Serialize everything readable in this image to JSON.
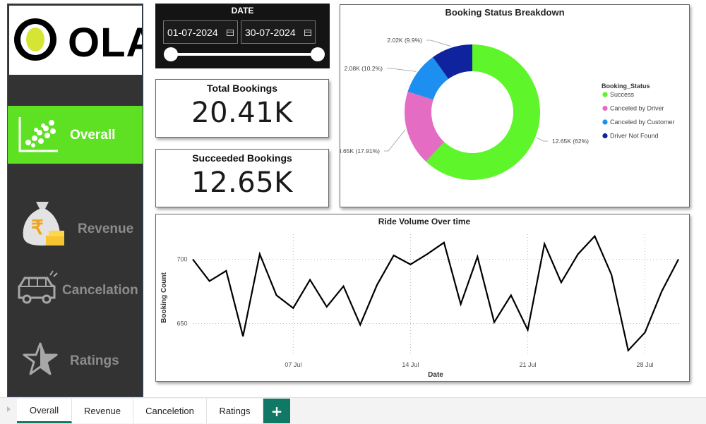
{
  "sidebar": {
    "logo_text": "OLA",
    "items": [
      {
        "label": "Overall",
        "icon": "scatter-chart-icon",
        "active": true
      },
      {
        "label": "Revenue",
        "icon": "money-bag-icon",
        "active": false
      },
      {
        "label": "Cancelation",
        "icon": "car-icon",
        "active": false
      },
      {
        "label": "Ratings",
        "icon": "star-icon",
        "active": false
      }
    ]
  },
  "date_filter": {
    "title": "DATE",
    "start": "01-07-2024",
    "end": "30-07-2024"
  },
  "kpis": {
    "total_bookings": {
      "title": "Total Bookings",
      "value": "20.41K"
    },
    "succeeded_bookings": {
      "title": "Succeeded Bookings",
      "value": "12.65K"
    }
  },
  "donut": {
    "title": "Booking Status Breakdown",
    "legend_title": "Booking_Status",
    "slices": [
      {
        "name": "Success",
        "value": 12650,
        "label": "12.65K (62%)",
        "color": "#5ef52a"
      },
      {
        "name": "Canceled by Driver",
        "value": 3650,
        "label": "3.65K (17.91%)",
        "color": "#e46cc3"
      },
      {
        "name": "Canceled by Customer",
        "value": 2080,
        "label": "2.08K (10.2%)",
        "color": "#1c8ff0"
      },
      {
        "name": "Driver Not Found",
        "value": 2020,
        "label": "2.02K (9.9%)",
        "color": "#10239e"
      }
    ]
  },
  "chart_data": {
    "type": "line",
    "title": "Ride Volume Over time",
    "xlabel": "Date",
    "ylabel": "Booking Count",
    "x_ticks": [
      "07 Jul",
      "14 Jul",
      "21 Jul",
      "28 Jul"
    ],
    "y_ticks": [
      650,
      700
    ],
    "ylim": [
      625,
      725
    ],
    "grid": true,
    "series": [
      {
        "x": [
          "2024-07-01",
          "2024-07-02",
          "2024-07-03",
          "2024-07-04",
          "2024-07-05",
          "2024-07-06",
          "2024-07-07",
          "2024-07-08",
          "2024-07-09",
          "2024-07-10",
          "2024-07-11",
          "2024-07-12",
          "2024-07-13",
          "2024-07-14",
          "2024-07-15",
          "2024-07-16",
          "2024-07-17",
          "2024-07-18",
          "2024-07-19",
          "2024-07-20",
          "2024-07-21",
          "2024-07-22",
          "2024-07-23",
          "2024-07-24",
          "2024-07-25",
          "2024-07-26",
          "2024-07-27",
          "2024-07-28",
          "2024-07-29",
          "2024-07-30"
        ],
        "values": [
          700,
          683,
          691,
          640,
          704,
          672,
          662,
          684,
          663,
          679,
          649,
          680,
          703,
          696,
          704,
          713,
          665,
          702,
          651,
          672,
          645,
          712,
          682,
          704,
          718,
          688,
          629,
          643,
          675,
          700
        ],
        "color": "#000000"
      }
    ]
  },
  "tabs": {
    "items": [
      "Overall",
      "Revenue",
      "Canceletion",
      "Ratings"
    ],
    "add_label": "+"
  }
}
